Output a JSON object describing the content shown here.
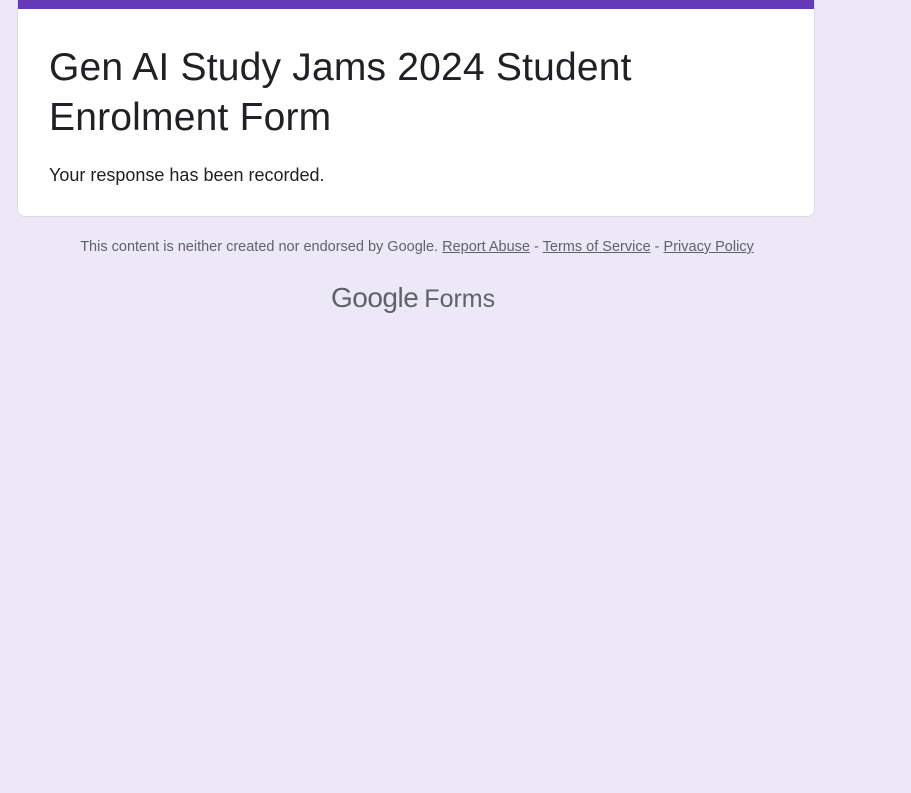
{
  "form": {
    "title": "Gen AI Study Jams 2024 Student Enrolment Form",
    "confirmation_message": "Your response has been recorded.",
    "accent_color": "#673ab7",
    "background_color": "#ede8f7"
  },
  "footer": {
    "disclaimer": "This content is neither created nor endorsed by Google.",
    "report_abuse_label": "Report Abuse",
    "separator": "-",
    "terms_label": "Terms of Service",
    "privacy_label": "Privacy Policy"
  },
  "brand": {
    "google_word": "Google",
    "product_word": "Forms"
  }
}
